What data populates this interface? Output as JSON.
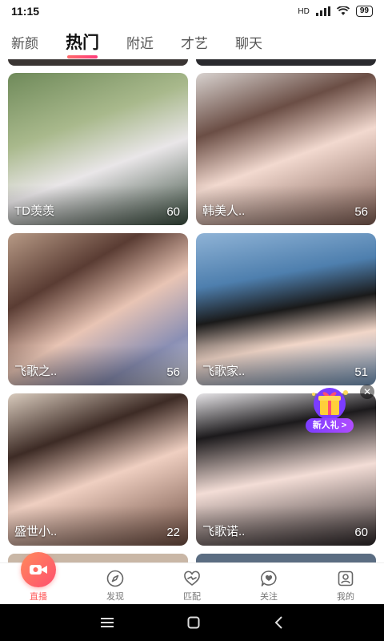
{
  "status_bar": {
    "time": "11:15",
    "network": "HD",
    "battery": "99"
  },
  "tabs": [
    {
      "label": "新颜"
    },
    {
      "label": "热门"
    },
    {
      "label": "附近"
    },
    {
      "label": "才艺"
    },
    {
      "label": "聊天"
    }
  ],
  "cards": [
    {
      "name": "TD羡羡",
      "count": "60"
    },
    {
      "name": "韩美人..",
      "count": "56"
    },
    {
      "name": "飞歌之..",
      "count": "56"
    },
    {
      "name": "飞歌家..",
      "count": "51"
    },
    {
      "name": "盛世小..",
      "count": "22"
    },
    {
      "name": "飞歌诺..",
      "count": "60"
    }
  ],
  "gift_badge": {
    "label": "新人礼 >"
  },
  "bottom_nav": [
    {
      "label": "直播",
      "icon": "live-camera-icon"
    },
    {
      "label": "发现",
      "icon": "compass-icon"
    },
    {
      "label": "匹配",
      "icon": "heart-link-icon"
    },
    {
      "label": "关注",
      "icon": "heart-chat-icon"
    },
    {
      "label": "我的",
      "icon": "profile-icon"
    }
  ]
}
